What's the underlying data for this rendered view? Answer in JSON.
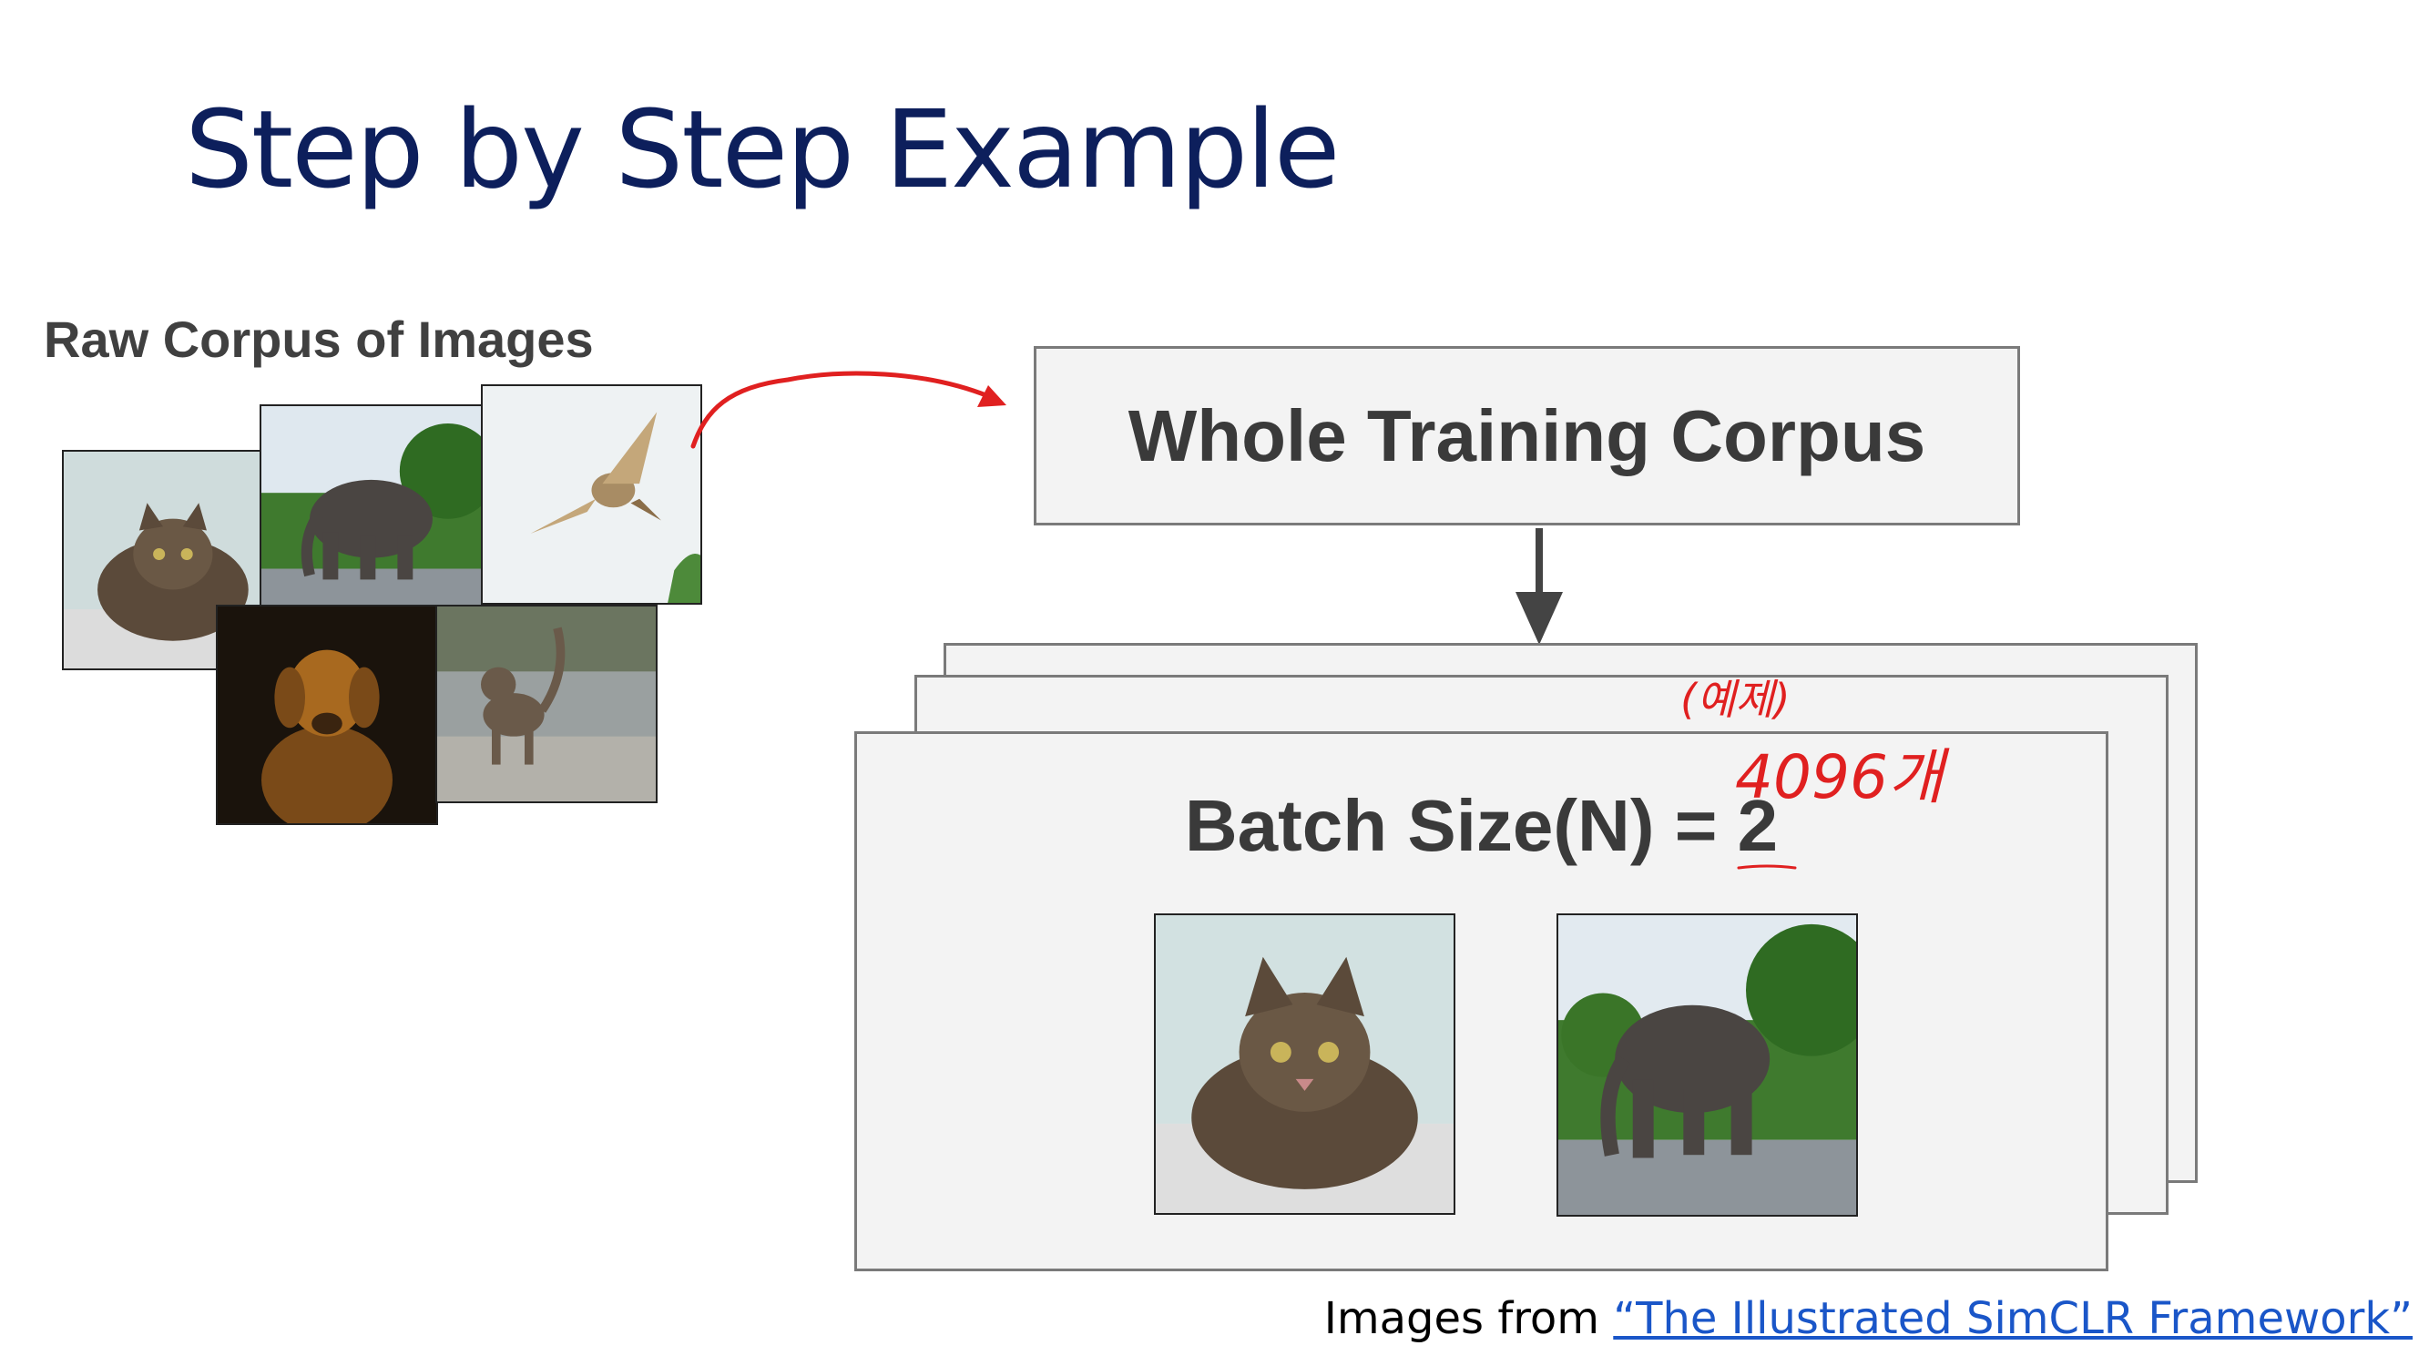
{
  "slide": {
    "title": "Step by Step Example"
  },
  "left_panel": {
    "label": "Raw Corpus of Images",
    "images": [
      "cat-photo",
      "elephant-photo",
      "bird-photo",
      "golden-retriever-photo",
      "cat-walking-photo"
    ]
  },
  "diagram": {
    "corpus_box_label": "Whole Training Corpus",
    "batch_label": "Batch Size(N) = 2",
    "batch_images": [
      "cat-photo",
      "elephant-photo"
    ],
    "colors": {
      "box_fill": "#f3f3f3",
      "box_border": "#7a7a7a",
      "arrow": "#444444",
      "annotation": "#e02020"
    }
  },
  "annotations": {
    "handwritten_line1": "(예제)",
    "handwritten_line2": "4096개"
  },
  "credit": {
    "prefix": "Images from ",
    "link_text": "“The Illustrated SimCLR Framework”"
  }
}
